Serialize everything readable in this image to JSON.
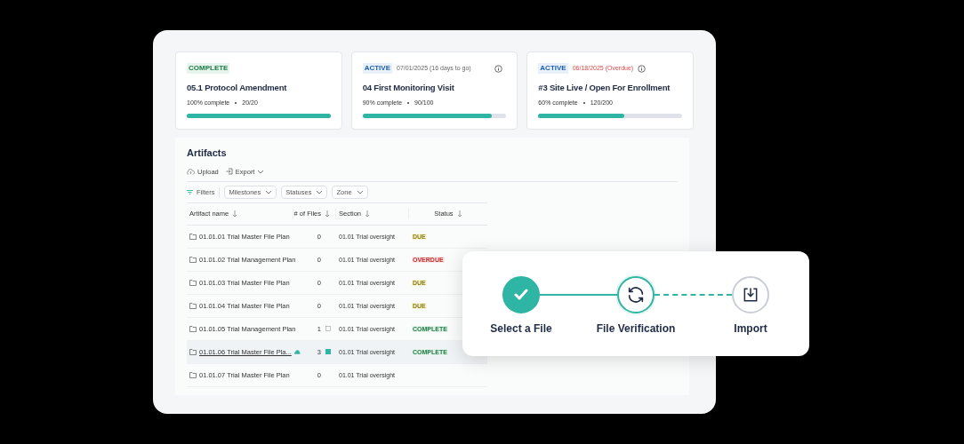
{
  "milestones": [
    {
      "status": {
        "label": "COMPLETE",
        "kind": "complete"
      },
      "info": false,
      "title": "05.1 Protocol Amendment",
      "percent": "100% complete",
      "count": "20/20",
      "level": 1.0
    },
    {
      "status": {
        "label": "ACTIVE",
        "kind": "active"
      },
      "date": {
        "text": "07/01/2025 (16 days to go)",
        "overdue": false
      },
      "info": true,
      "title": "04 First Monitoring Visit",
      "percent": "90% complete",
      "count": "90/100",
      "level": 0.9
    },
    {
      "status": {
        "label": "ACTIVE",
        "kind": "active"
      },
      "date": {
        "text": "06/18/2025 (Overdue)",
        "overdue": true
      },
      "info": true,
      "title": "#3 Site Live / Open For Enrollment",
      "percent": "60% complete",
      "count": "120/200",
      "level": 0.6
    }
  ],
  "artifacts": {
    "title": "Artifacts",
    "actions": [
      {
        "label": "Upload",
        "kind": "upload"
      },
      {
        "label": "Export",
        "kind": "export"
      }
    ],
    "filters_label": "Filters",
    "filters": [
      "Milestones",
      "Statuses",
      "Zone"
    ],
    "columns": [
      "Artifact name",
      "# of Files",
      "Section",
      "Status"
    ],
    "rows": [
      {
        "name": "01.01.01 Trial Master File Plan",
        "files": "0",
        "attachment": false,
        "synced": false,
        "cloud": false,
        "section": "01.01 Trial oversight",
        "status": {
          "label": "DUE",
          "kind": "due"
        },
        "selected": false
      },
      {
        "name": "01.01.02 Trial Management Plan",
        "files": "0",
        "attachment": false,
        "synced": false,
        "cloud": false,
        "section": "01.01 Trial oversight",
        "status": {
          "label": "OVERDUE",
          "kind": "overdue"
        },
        "selected": false
      },
      {
        "name": "01.01.03 Trial Master File Plan",
        "files": "0",
        "attachment": false,
        "synced": false,
        "cloud": false,
        "section": "01.01 Trial oversight",
        "status": {
          "label": "DUE",
          "kind": "due"
        },
        "selected": false
      },
      {
        "name": "01.01.04 Trial Master File Plan",
        "files": "0",
        "attachment": false,
        "synced": false,
        "cloud": false,
        "section": "01.01 Trial oversight",
        "status": {
          "label": "DUE",
          "kind": "due"
        },
        "selected": false
      },
      {
        "name": "01.01.05 Trial Management Plan",
        "files": "1",
        "attachment": true,
        "synced": false,
        "cloud": false,
        "section": "01.01 Trial oversight",
        "status": {
          "label": "COMPLETE",
          "kind": "complete"
        },
        "selected": false
      },
      {
        "name": "01.01.06 Trial Master File Pla...",
        "files": "3",
        "attachment": true,
        "synced": true,
        "cloud": true,
        "section": "01.01 Trial oversight",
        "status": {
          "label": "COMPLETE",
          "kind": "complete"
        },
        "selected": true
      },
      {
        "name": "01.01.07 Trial Master File Plan",
        "files": "0",
        "attachment": false,
        "synced": false,
        "cloud": false,
        "section": "01.01 Trial oversight",
        "selected": false
      }
    ]
  },
  "steps": [
    {
      "label": "Select a File",
      "completed": true,
      "current": false,
      "kind": "check"
    },
    {
      "label": "File Verification",
      "completed": false,
      "current": true,
      "kind": "sync"
    },
    {
      "label": "Import",
      "completed": false,
      "current": false,
      "kind": "import"
    }
  ]
}
